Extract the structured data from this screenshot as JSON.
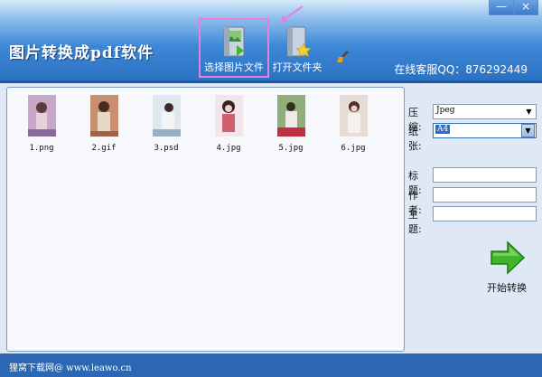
{
  "app": {
    "title": "图片转换成pdf软件",
    "service": "在线客服QQ：876292449"
  },
  "window_buttons": {
    "minimize": "—",
    "close": "×"
  },
  "toolbar": {
    "select_images": "选择图片文件",
    "open_folder": "打开文件夹"
  },
  "files": [
    {
      "name": "1.png"
    },
    {
      "name": "2.gif"
    },
    {
      "name": "3.psd"
    },
    {
      "name": "4.jpg"
    },
    {
      "name": "5.jpg"
    },
    {
      "name": "6.jpg"
    }
  ],
  "form": {
    "compress_label": "压缩:",
    "compress_value": "Jpeg",
    "paper_label": "纸张:",
    "paper_value": "A4",
    "title_label": "标题:",
    "title_value": "",
    "author_label": "作者:",
    "author_value": "",
    "subject_label": "主题:",
    "subject_value": ""
  },
  "start_button": {
    "label": "开始转换"
  },
  "status": {
    "text": "狸窝下载网@ www.leawo.cn"
  },
  "icons": {
    "select_images": "image-folder-icon",
    "open_folder": "folder-star-icon",
    "clean": "broom-icon",
    "start": "green-arrow-icon",
    "dropdown": "chevron-down-icon"
  },
  "colors": {
    "header": "#3d88d6",
    "highlight": "#e87fd9",
    "status_bar": "#2b67b3",
    "accent_green": "#3fb52a"
  }
}
